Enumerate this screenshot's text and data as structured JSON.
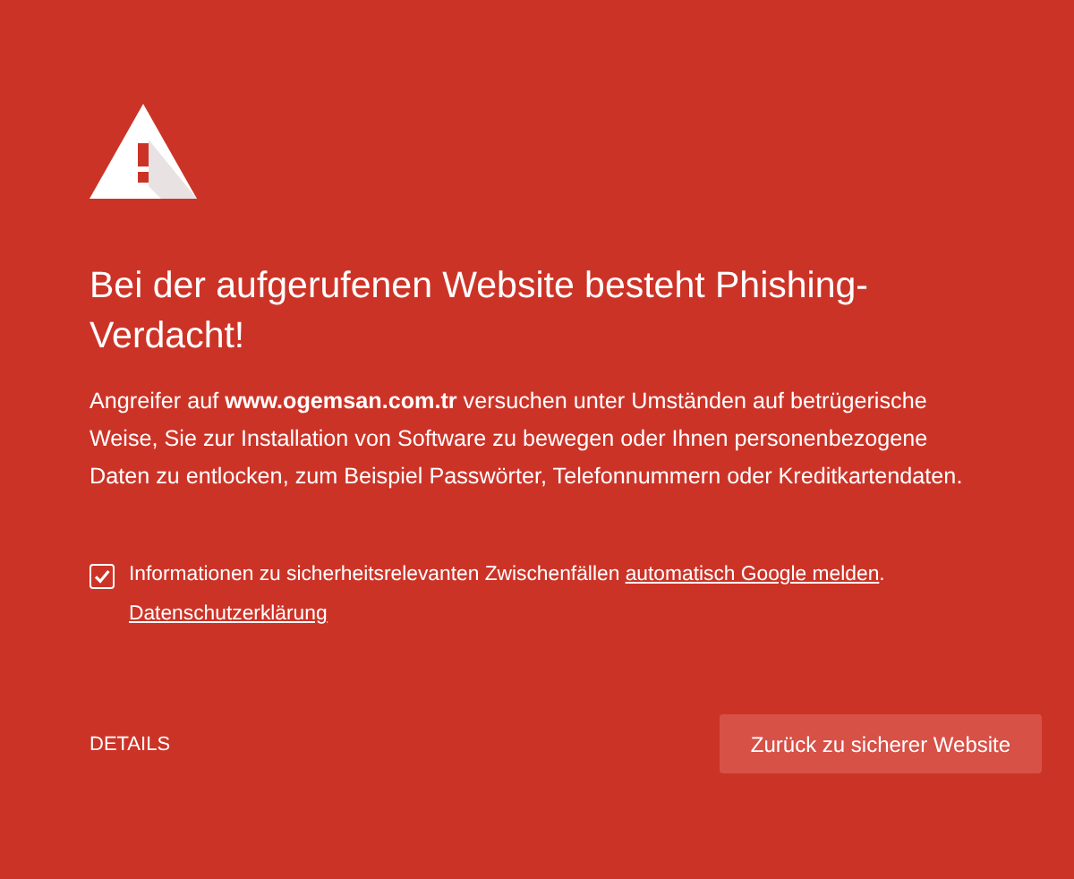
{
  "heading": "Bei der aufgerufenen Website besteht Phishing-Verdacht!",
  "message": "Angreifer auf **www.ogemsan.com.tr** versuchen unter Umständen auf betrügerische Weise, Sie zur Installation von Software zu bewegen oder Ihnen personenbezogene Daten zu entlocken, zum Beispiel Passwörter, Telefonnummern oder Kreditkartendaten.",
  "report": {
    "checked": true,
    "text": "Informationen zu sicherheitsrelevanten Zwischenfällen ",
    "link": "automatisch Google melden",
    "text_after": ".",
    "privacy_link": "Datenschutzerklärung"
  },
  "details_button": "DETAILS",
  "back_button": "Zurück zu sicherer Website"
}
